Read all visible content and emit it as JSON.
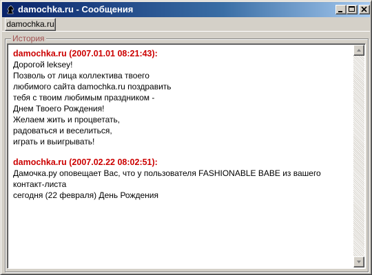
{
  "window": {
    "title": "damochka.ru - Сообщения",
    "icons": {
      "app": "chess-knight-icon",
      "minimize": "minimize-icon",
      "maximize": "maximize-icon",
      "close": "close-icon"
    }
  },
  "tabs": [
    {
      "label": "damochka.ru",
      "selected": true
    }
  ],
  "history": {
    "legend": "История",
    "messages": [
      {
        "header": "damochka.ru (2007.01.01 08:21:43):",
        "body": "Дорогой leksey!\nПозволь от лица коллектива твоего\nлюбимого сайта damochka.ru поздравить\nтебя с твоим любимым праздником -\nДнем Твоего Рождения!\nЖелаем жить и процветать,\nрадоваться и веселиться,\nиграть и выигрывать!"
      },
      {
        "header": "damochka.ru (2007.02.22 08:02:51):",
        "body": "Дамочка.ру оповещает Вас, что у пользователя FASHIONABLE BABE из вашего контакт-листа\nсегодня (22 февраля) День Рождения"
      }
    ]
  },
  "colors": {
    "titlebar_start": "#0a246a",
    "titlebar_end": "#a6caf0",
    "message_header": "#cc0000",
    "legend": "#a05050",
    "window_face": "#d4d0c8"
  }
}
